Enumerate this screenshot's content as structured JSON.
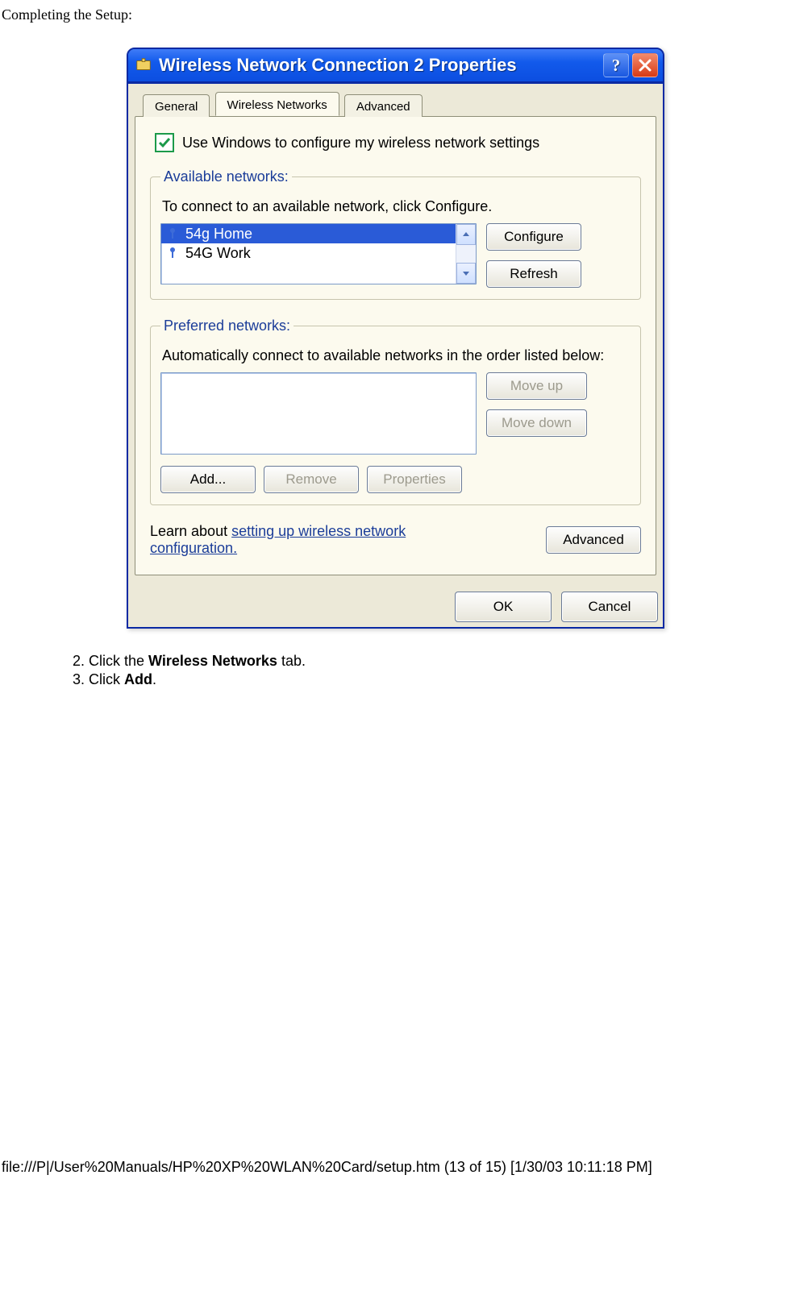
{
  "page_heading": "Completing the Setup:",
  "dialog": {
    "title": "Wireless Network Connection 2 Properties",
    "tabs": {
      "general": "General",
      "wireless": "Wireless Networks",
      "advanced": "Advanced"
    },
    "checkbox_label": "Use Windows to configure my wireless network settings",
    "available": {
      "legend": "Available networks:",
      "desc": "To connect to an available network, click Configure.",
      "items": [
        "54g Home",
        "54G Work"
      ],
      "configure_btn": "Configure",
      "refresh_btn": "Refresh"
    },
    "preferred": {
      "legend": "Preferred networks:",
      "desc": "Automatically connect to available networks in the order listed below:",
      "moveup_btn": "Move up",
      "movedown_btn": "Move down",
      "add_btn": "Add...",
      "remove_btn": "Remove",
      "properties_btn": "Properties"
    },
    "learn_prefix": "Learn about ",
    "learn_link": "setting up wireless network configuration.",
    "advanced_btn": "Advanced",
    "ok_btn": "OK",
    "cancel_btn": "Cancel"
  },
  "instructions": {
    "step2_pre": "Click the ",
    "step2_bold": "Wireless Networks",
    "step2_post": " tab.",
    "step3_pre": "Click ",
    "step3_bold": "Add",
    "step3_post": "."
  },
  "footer": "file:///P|/User%20Manuals/HP%20XP%20WLAN%20Card/setup.htm (13 of 15) [1/30/03 10:11:18 PM]"
}
